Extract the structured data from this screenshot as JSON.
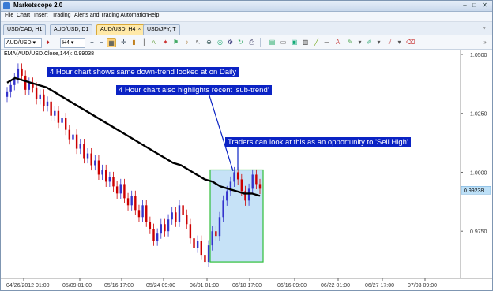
{
  "window": {
    "title": "Marketscope 2.0",
    "controls": [
      "–",
      "□",
      "✕"
    ]
  },
  "menu": [
    "File",
    "Chart",
    "Insert",
    "Trading",
    "Alerts and Trading Automation",
    "Help"
  ],
  "tabs": [
    {
      "label": "USD/CAD, H1",
      "active": false
    },
    {
      "label": "AUD/USD, D1",
      "active": false
    },
    {
      "label": "AUD/USD, H4",
      "active": true
    },
    {
      "label": "USD/JPY, T",
      "active": false
    }
  ],
  "toolbar": {
    "symbol": "AUD/USD",
    "timeframe": "H4"
  },
  "indicator_label": "EMA(AUD/USD.Close,144): 0.99038",
  "chart_data": {
    "type": "candlestick",
    "symbol": "AUD/USD",
    "timeframe": "H4",
    "x_tick_labels": [
      "04/26/2012 01:00",
      "05/09 01:00",
      "05/16 17:00",
      "05/24 09:00",
      "06/01 01:00",
      "06/10 17:00",
      "06/16 09:00",
      "06/22 01:00",
      "06/27 17:00",
      "07/03 09:00"
    ],
    "y_tick_labels": [
      "1.0500",
      "1.0250",
      "1.0000",
      "0.9750"
    ],
    "ylim": [
      0.955,
      1.051
    ],
    "current_price_label": "0.99238",
    "close_series": [
      1.034,
      1.037,
      1.04,
      1.044,
      1.041,
      1.035,
      1.038,
      1.036,
      1.031,
      1.033,
      1.028,
      1.03,
      1.024,
      1.026,
      1.021,
      1.023,
      1.018,
      1.014,
      1.016,
      1.01,
      1.012,
      1.006,
      1.008,
      1.003,
      1.005,
      0.999,
      1.001,
      0.996,
      0.998,
      0.994,
      0.991,
      0.995,
      0.989,
      0.986,
      0.99,
      0.984,
      0.981,
      0.986,
      0.979,
      0.976,
      0.971,
      0.974,
      0.978,
      0.975,
      0.98,
      0.983,
      0.979,
      0.986,
      0.982,
      0.978,
      0.972,
      0.968,
      0.971,
      0.965,
      0.962,
      0.969,
      0.975,
      0.973,
      0.981,
      0.988,
      0.992,
      0.996,
      1.0,
      0.997,
      0.992,
      0.988,
      0.993,
      0.999,
      0.995,
      0.993
    ],
    "ema_series": [
      1.038,
      1.04,
      1.039,
      1.038,
      1.037,
      1.036,
      1.034,
      1.032,
      1.03,
      1.028,
      1.026,
      1.024,
      1.022,
      1.02,
      1.018,
      1.016,
      1.014,
      1.012,
      1.01,
      1.008,
      1.006,
      1.004,
      1.003,
      1.001,
      0.999,
      0.997,
      0.996,
      0.994,
      0.993,
      0.992,
      0.991,
      0.991,
      0.99
    ],
    "highlight_box": {
      "y_range": [
        0.962,
        1.001
      ]
    },
    "annotations": [
      "4 Hour chart shows same down-trend looked at on Daily",
      "4 Hour chart also highlights recent 'sub-trend'",
      "Traders can look at this as an opportunity to 'Sell High'"
    ],
    "colors": {
      "bull": "#3333cc",
      "bear": "#cc0000",
      "ema": "#000000",
      "box_fill": "#c6e2f7",
      "box_stroke": "#2fbf3a",
      "callout": "#0b23c4",
      "price_tag": "#bde0f7"
    }
  }
}
